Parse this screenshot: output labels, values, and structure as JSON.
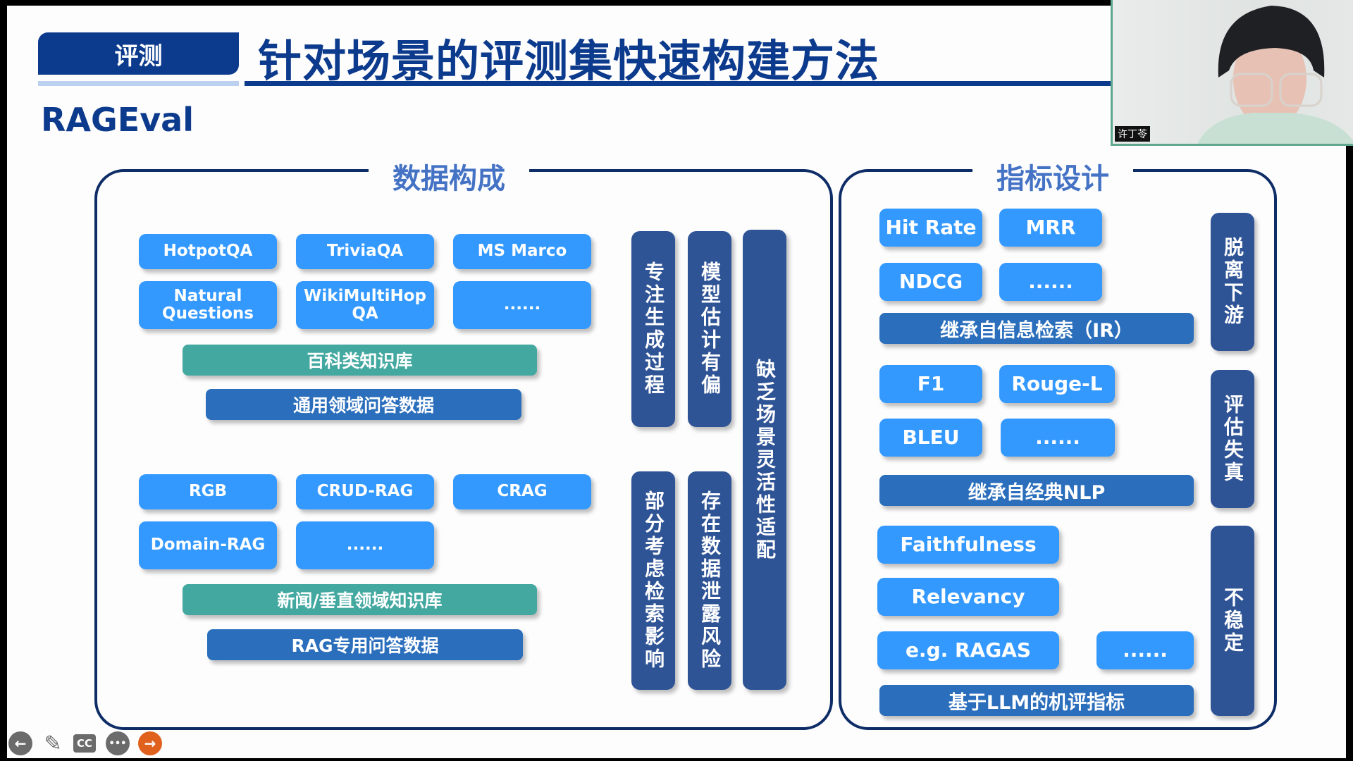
{
  "header": {
    "tag": "评测",
    "title": "针对场景的评测集快速构建方法",
    "subtitle": "RAGEval"
  },
  "data_panel": {
    "title": "数据构成",
    "general": {
      "datasets": [
        "HotpotQA",
        "TriviaQA",
        "MS  Marco",
        "Natural Questions",
        "WikiMultiHop QA",
        "......"
      ],
      "knowledge_base": "百科类知识库",
      "qa_data": "通用领域问答数据"
    },
    "rag": {
      "datasets": [
        "RGB",
        "CRUD-RAG",
        "CRAG",
        "Domain-RAG",
        "......"
      ],
      "knowledge_base": "新闻/垂直领域知识库",
      "qa_data": "RAG专用问答数据"
    },
    "issues": [
      "专注生成过程",
      "模型估计有偏",
      "部分考虑检索影响",
      "存在数据泄露风险",
      "缺乏场景灵活性适配"
    ]
  },
  "metric_panel": {
    "title": "指标设计",
    "ir": {
      "metrics": [
        "Hit Rate",
        "MRR",
        "NDCG",
        "......"
      ],
      "label": "继承自信息检索（IR）",
      "issue": "脱离下游"
    },
    "nlp": {
      "metrics": [
        "F1",
        "Rouge-L",
        "BLEU",
        "......"
      ],
      "label": "继承自经典NLP",
      "issue": "评估失真"
    },
    "llm": {
      "metrics": [
        "Faithfulness",
        "Relevancy",
        "e.g. RAGAS",
        "......"
      ],
      "label": "基于LLM的机评指标",
      "issue": "不稳定"
    }
  },
  "webcam": {
    "name": "许丁苓"
  },
  "controls": {
    "back": "←",
    "pen": "✎",
    "cc": "CC",
    "more": "•••",
    "next": "→"
  }
}
